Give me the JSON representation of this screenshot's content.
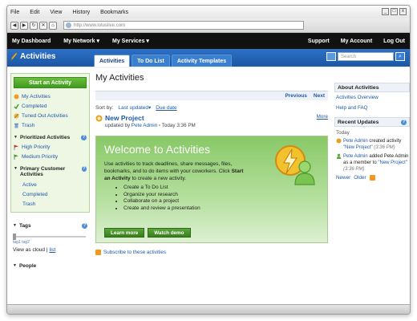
{
  "menubar": {
    "items": [
      "File",
      "Edit",
      "View",
      "History",
      "Bookmarks"
    ]
  },
  "window_controls": {
    "minimize": "_",
    "maximize": "□",
    "close": "x"
  },
  "browser": {
    "url": "http://www.lotuslive.com",
    "nav_icons": [
      "back-icon",
      "forward-icon",
      "reload-icon",
      "stop-icon",
      "home-icon"
    ]
  },
  "appnav": {
    "my_dashboard": "My Dashboard",
    "my_network": "My Network ▾",
    "my_services": "My Services ▾",
    "support": "Support",
    "my_account": "My Account",
    "log_out": "Log Out"
  },
  "header": {
    "title": "Activities",
    "tabs": [
      {
        "label": "Activities",
        "active": true
      },
      {
        "label": "To Do List",
        "active": false
      },
      {
        "label": "Activity Templates",
        "active": false
      }
    ],
    "search_placeholder": "Search"
  },
  "sidebar": {
    "start_button": "Start an Activity",
    "links": [
      {
        "label": "My Activities",
        "icon": "activities-icon"
      },
      {
        "label": "Completed",
        "icon": "checkmark-icon"
      },
      {
        "label": "Tuned Out Activities",
        "icon": "tuned-out-icon"
      },
      {
        "label": "Trash",
        "icon": "trash-icon"
      }
    ],
    "prioritized_heading": "Prioritized Activities",
    "priority_links": [
      {
        "label": "High Priority",
        "icon": "red-flag-icon"
      },
      {
        "label": "Medium Priority",
        "icon": "green-flag-icon"
      }
    ],
    "primary_customer_heading": "Primary Customer Activities",
    "customer_links": [
      "Active",
      "Completed",
      "Trash"
    ],
    "tags_heading": "Tags",
    "tag_words": [
      "tag1",
      "tag2"
    ],
    "view_as_cloud": "View as cloud",
    "view_list": "list",
    "people_heading": "People"
  },
  "main": {
    "page_title": "My Activities",
    "previous": "Previous",
    "next": "Next",
    "sort_by": "Sort by:",
    "sort_last_updated": "Last updated▾",
    "sort_due_date": "Due date",
    "activity_title": "New Project",
    "updated_by_prefix": "updated by",
    "updated_by_name": "Pete Admin",
    "updated_time": "Today 3:36 PM",
    "more": "More",
    "welcome_title": "Welcome to Activities",
    "welcome_desc_pre": "Use activities to track deadlines, share messages, files, bookmarks, and to do items with your coworkers. Click",
    "welcome_desc_link": "Start an Activity",
    "welcome_desc_post": "to create a new activity.",
    "welcome_items": [
      "Create a To Do List",
      "Organize your research",
      "Collaborate on a project",
      "Create and review a presentation"
    ],
    "learn_more": "Learn more",
    "watch_demo": "Watch demo",
    "subscribe": "Subscribe to these activities"
  },
  "rside": {
    "about_heading": "About Activities",
    "overview": "Activities Overview",
    "help": "Help and FAQ",
    "recent_heading": "Recent Updates",
    "today": "Today",
    "update1_name": "Pete Admin",
    "update1_text": "created activity",
    "update1_link": "\"New Project\"",
    "update1_time": "(3:36 PM)",
    "update2_name": "Pete Admin",
    "update2_text": "added Pete Admin as a member to",
    "update2_link": "\"New Project\"",
    "update2_time": "(3:36 PM)",
    "newer": "Newer",
    "older": "Older"
  },
  "colors": {
    "app_nav": "#111111",
    "title_bar": "#2d71c4",
    "start_button": "#4fa52a",
    "link": "#1d5aa8",
    "welcome_green": "#88c866"
  }
}
